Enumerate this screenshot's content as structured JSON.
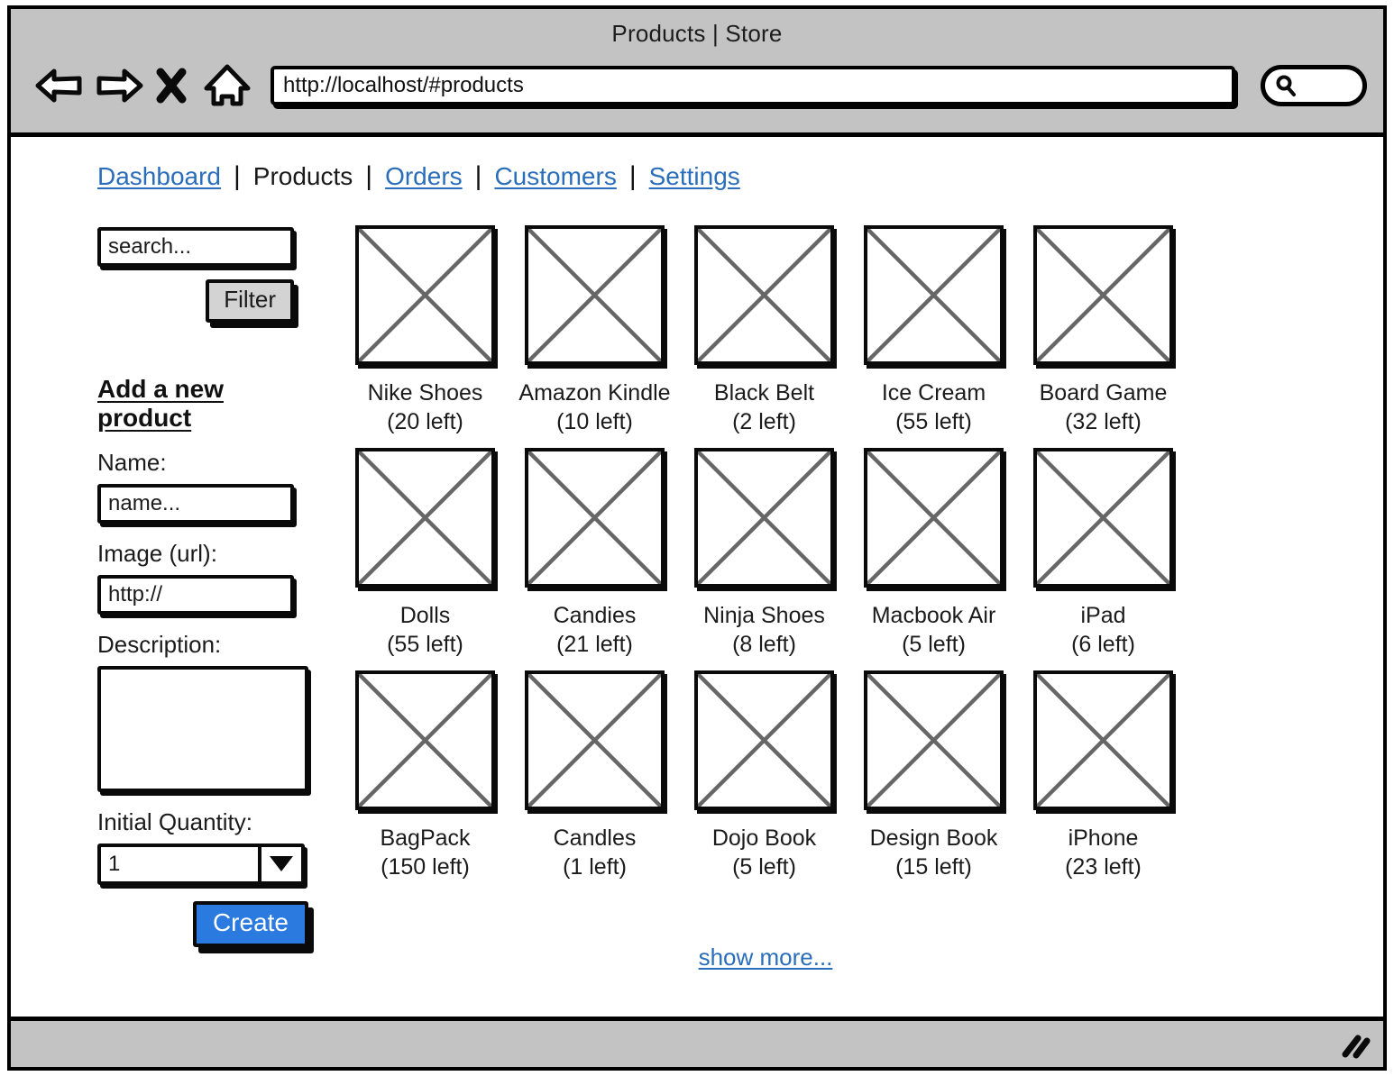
{
  "browser": {
    "window_title": "Products | Store",
    "url": "http://localhost/#products",
    "icons": {
      "back": "back-arrow-icon",
      "forward": "forward-arrow-icon",
      "stop": "stop-x-icon",
      "home": "home-icon",
      "search": "search-magnifier-icon",
      "resize": "resize-grip-icon"
    }
  },
  "topnav": {
    "items": [
      {
        "label": "Dashboard",
        "active": false
      },
      {
        "label": "Products",
        "active": true
      },
      {
        "label": "Orders",
        "active": false
      },
      {
        "label": "Customers",
        "active": false
      },
      {
        "label": "Settings",
        "active": false
      }
    ],
    "separator": "|"
  },
  "sidebar": {
    "search": {
      "placeholder": "search...",
      "value": "search..."
    },
    "filter_button": "Filter",
    "form_title": "Add a new product",
    "fields": {
      "name_label": "Name:",
      "name_value": "name...",
      "image_label": "Image (url):",
      "image_value": "http://",
      "description_label": "Description:",
      "description_value": "",
      "quantity_label": "Initial Quantity:",
      "quantity_value": "1"
    },
    "create_button": "Create"
  },
  "products": {
    "rows": [
      [
        {
          "name": "Nike Shoes",
          "stock": "(20 left)"
        },
        {
          "name": "Amazon Kindle",
          "stock": "(10 left)"
        },
        {
          "name": "Black Belt",
          "stock": "(2 left)"
        },
        {
          "name": "Ice Cream",
          "stock": "(55 left)"
        },
        {
          "name": "Board Game",
          "stock": "(32 left)"
        }
      ],
      [
        {
          "name": "Dolls",
          "stock": "(55 left)"
        },
        {
          "name": "Candies",
          "stock": "(21 left)"
        },
        {
          "name": "Ninja Shoes",
          "stock": "(8 left)"
        },
        {
          "name": "Macbook Air",
          "stock": "(5 left)"
        },
        {
          "name": "iPad",
          "stock": "(6 left)"
        }
      ],
      [
        {
          "name": "BagPack",
          "stock": "(150 left)"
        },
        {
          "name": "Candles",
          "stock": "(1 left)"
        },
        {
          "name": "Dojo Book",
          "stock": "(5 left)"
        },
        {
          "name": "Design Book",
          "stock": "(15 left)"
        },
        {
          "name": "iPhone",
          "stock": "(23 left)"
        }
      ]
    ],
    "show_more": "show more..."
  },
  "colors": {
    "chrome_gray": "#c3c3c3",
    "link_blue": "#2a6ebb",
    "primary_button_blue": "#2a7ae0",
    "button_gray": "#d3d3d3",
    "ink": "#0a0a0a",
    "placeholder_stroke": "#666666"
  }
}
